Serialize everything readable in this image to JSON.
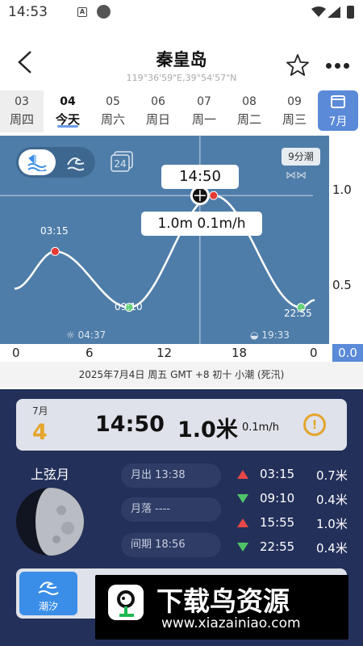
{
  "status_bar": {
    "time": "14:53",
    "notif_letter": "A"
  },
  "header": {
    "title": "秦皇岛",
    "coords": "119°36'59\"E,39°54'57\"N"
  },
  "dates": [
    {
      "num": "03",
      "weekday": "周四"
    },
    {
      "num": "04",
      "weekday": "今天"
    },
    {
      "num": "05",
      "weekday": "周六"
    },
    {
      "num": "06",
      "weekday": "周日"
    },
    {
      "num": "07",
      "weekday": "周一"
    },
    {
      "num": "08",
      "weekday": "周二"
    },
    {
      "num": "09",
      "weekday": "周三"
    }
  ],
  "month_button": "7月",
  "chart": {
    "tide_type_label": "9分潮",
    "fish_glyph": "⋈⋈",
    "day_box_label": "24",
    "cursor_time": "14:50",
    "cursor_value": "1.0m  0.1m/h",
    "sunrise": "04:37",
    "sunset": "19:33",
    "extremes": [
      {
        "time": "03:15",
        "kind": "high"
      },
      {
        "time": "09:10",
        "kind": "low"
      },
      {
        "time": "22:55",
        "kind": "low"
      }
    ],
    "y_ticks": [
      "1.0",
      "0.5",
      "0.0"
    ],
    "x_ticks": [
      "0",
      "6",
      "12",
      "18",
      "0"
    ],
    "date_line": "2025年7月4日  周五  GMT +8  初十  小潮 (死汛)"
  },
  "chart_data": {
    "type": "line",
    "x_unit": "hour",
    "points": [
      {
        "x": 0,
        "y": 0.5
      },
      {
        "x": 3.25,
        "y": 0.7
      },
      {
        "x": 9.17,
        "y": 0.4
      },
      {
        "x": 15.92,
        "y": 1.0
      },
      {
        "x": 22.92,
        "y": 0.4
      },
      {
        "x": 24,
        "y": 0.44
      }
    ],
    "x_ticks": [
      0,
      6,
      12,
      18,
      24
    ],
    "y_ticks": [
      0.0,
      0.5,
      1.0
    ],
    "ylim": [
      0.0,
      1.2
    ],
    "cursor": {
      "x": 14.83,
      "y": 1.0
    },
    "colors": {
      "background": "#4f7da9",
      "line": "#ffffff",
      "high": "#e53935",
      "low": "#66d17a"
    }
  },
  "summary_card": {
    "month": "7月",
    "day": "4",
    "time": "14:50",
    "height": "1.0米",
    "rate": "0.1m/h",
    "warn_glyph": "!"
  },
  "moon": {
    "phase": "上弦月",
    "moonrise": "月出 13:38",
    "moonset": "月落 ----",
    "period": "间期 18:56"
  },
  "tides": [
    {
      "time": "03:15",
      "height": "0.7米",
      "dir": "up"
    },
    {
      "time": "09:10",
      "height": "0.4米",
      "dir": "down"
    },
    {
      "time": "15:55",
      "height": "1.0米",
      "dir": "up"
    },
    {
      "time": "22:55",
      "height": "0.4米",
      "dir": "down"
    }
  ],
  "bottom_tab": {
    "label": "潮汐"
  },
  "watermark": {
    "title": "下载鸟资源",
    "url": "www.xiazainiao.com"
  }
}
